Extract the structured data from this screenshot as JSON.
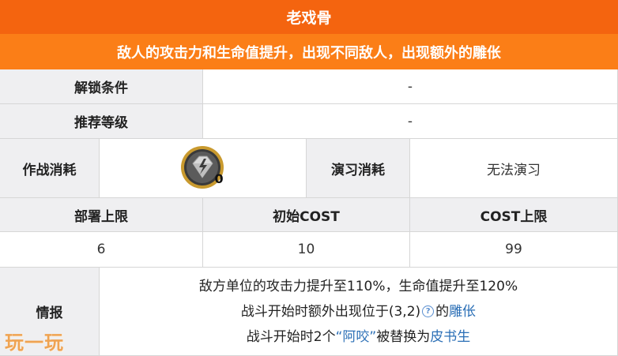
{
  "title": "老戏骨",
  "subtitle": "敌人的攻击力和生命值提升，出现不同敌人，出现额外的雕伥",
  "rows": {
    "unlock_label": "解锁条件",
    "unlock_value": "-",
    "recommend_label": "推荐等级",
    "recommend_value": "-",
    "battle_cost_label": "作战消耗",
    "battle_cost_value": "0",
    "battle_cost_icon": "sanity-medal-icon",
    "practice_cost_label": "演习消耗",
    "practice_cost_value": "无法演习",
    "deploy_limit_label": "部署上限",
    "initial_cost_label": "初始COST",
    "cost_limit_label": "COST上限",
    "deploy_limit_value": "6",
    "initial_cost_value": "10",
    "cost_limit_value": "99",
    "intel_label": "情报"
  },
  "intel": {
    "line1": "敌方单位的攻击力提升至110%，生命值提升至120%",
    "line2_prefix": "战斗开始时额外出现位于(3,2)",
    "line2_help": "?",
    "line2_middle": "的",
    "line2_link": "雕伥",
    "line3_prefix": "战斗开始时2个",
    "line3_link1": "“阿咬”",
    "line3_middle": "被替换为",
    "line3_link2": "皮书生"
  },
  "watermark": "玩一玩",
  "colors": {
    "title_bar": "#f4640f",
    "subtitle_bar": "#fb7e17",
    "header_bg": "#efeff1",
    "link": "#2b6fb6"
  }
}
